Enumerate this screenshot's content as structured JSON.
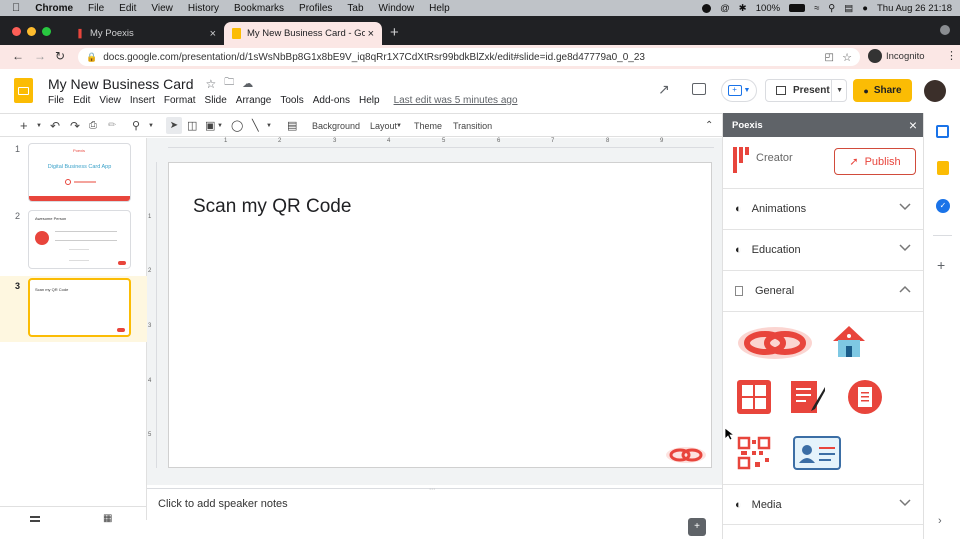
{
  "macbar": {
    "app": "Chrome",
    "menus": [
      "File",
      "Edit",
      "View",
      "History",
      "Bookmarks",
      "Profiles",
      "Tab",
      "Window",
      "Help"
    ],
    "battery": "100%",
    "datetime": "Thu Aug 26  21:18"
  },
  "tabs": [
    {
      "title": "My Poexis"
    },
    {
      "title": "My New Business Card - Goog"
    }
  ],
  "address": {
    "url": "docs.google.com/presentation/d/1sWsNbBp8G1x8bE9V_iq8qRr1X7CdXtRsr99bdkBlZxk/edit#slide=id.ge8d47779a0_0_23",
    "incognito": "Incognito"
  },
  "doc": {
    "title": "My New Business Card",
    "menus": [
      "File",
      "Edit",
      "View",
      "Insert",
      "Format",
      "Slide",
      "Arrange",
      "Tools",
      "Add-ons",
      "Help"
    ],
    "last_edit": "Last edit was 5 minutes ago",
    "present": "Present",
    "share": "Share"
  },
  "toolbar": {
    "background": "Background",
    "layout": "Layout",
    "theme": "Theme",
    "transition": "Transition"
  },
  "ruler": {
    "h": [
      "1",
      "2",
      "3",
      "4",
      "5",
      "6",
      "7",
      "8",
      "9"
    ],
    "v": [
      "1",
      "2",
      "3",
      "4",
      "5"
    ]
  },
  "slides": [
    {
      "num": "1",
      "brand": "Poexis",
      "title": "Digital Business Card App"
    },
    {
      "num": "2",
      "name": "Awesome Person"
    },
    {
      "num": "3",
      "text": "Scan my QR Code"
    }
  ],
  "slide": {
    "text": "Scan my QR Code"
  },
  "notes": {
    "placeholder": "Click to add speaker notes"
  },
  "sidebar": {
    "title": "Poexis",
    "creator": "Creator",
    "publish": "Publish",
    "sections": [
      "Animations",
      "Education",
      "General",
      "Media"
    ]
  },
  "colors": {
    "accent": "#e8453c",
    "share": "#fbbc04",
    "sidehead": "#5f6368",
    "active_thumb": "#fbbc04"
  }
}
